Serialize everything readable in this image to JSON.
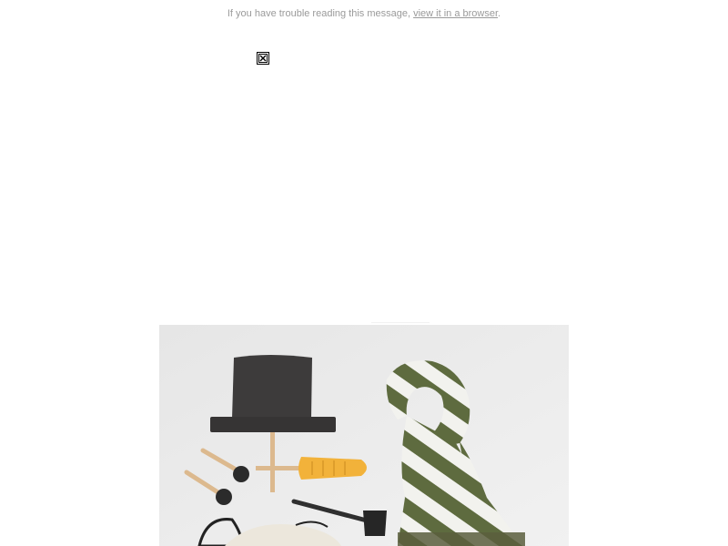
{
  "preheader": {
    "text": "If you have trouble reading this message, ",
    "link_label": "view it in a browser",
    "trailing": "."
  },
  "icons": {
    "broken_image": "broken-image-icon"
  },
  "colors": {
    "background": "#ffffff",
    "preheader_text": "#9a9a9a",
    "hero_background": "#ebebeb",
    "hat": "#3d3b3b",
    "scarf_green": "#5e6b3f",
    "scarf_white": "#f2f2ee",
    "carrot": "#f2b23a",
    "wood": "#dcb98e"
  }
}
